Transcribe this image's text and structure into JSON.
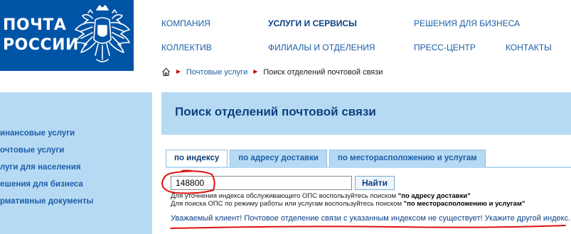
{
  "logo": {
    "line1": "ПОЧТА",
    "line2": "РОССИИ",
    "emblem": "double-headed-eagle-emblem"
  },
  "nav": {
    "company": "КОМПАНИЯ",
    "services": "УСЛУГИ И СЕРВИСЫ",
    "business": "РЕШЕНИЯ ДЛЯ БИЗНЕСА",
    "team": "КОЛЛЕКТИВ",
    "branches": "ФИЛИАЛЫ И ОТДЕЛЕНИЯ",
    "press": "ПРЕСС-ЦЕНТР",
    "contacts": "КОНТАКТЫ"
  },
  "breadcrumb": {
    "home_icon": "home-icon",
    "separator": "►",
    "postal_services": "Почтовые услуги",
    "current": "Поиск отделений почтовой связи"
  },
  "sidebar": {
    "items": [
      {
        "label": "инансовые услуги"
      },
      {
        "label": "очтовые услуги"
      },
      {
        "label": "луги для населения"
      },
      {
        "label": "ешения для бизнеса"
      },
      {
        "label": "рмативные документы"
      }
    ]
  },
  "main": {
    "title": "Поиск отделений почтовой связи",
    "tabs": [
      {
        "label": "по индексу",
        "active": true
      },
      {
        "label": "по адресу доставки",
        "active": false
      },
      {
        "label": "по месторасположению и услугам",
        "active": false
      }
    ],
    "index_value": "148800",
    "find_label": "Найти",
    "hint1_prefix": "Для уточнения индекса обслуживающего ОПС воспользуйтесь поиском ",
    "hint1_bold": "\"по адресу доставки\"",
    "hint2_prefix": "Для поиска ОПС по режиму работы или услугам воспользуйтесь поиском ",
    "hint2_bold": "\"по месторасположению и услугам\"",
    "error": "Уважаемый клиент! Почтовое отделение связи с указанным индексом не существует! Укажите другой индекс."
  },
  "colors": {
    "brand_blue": "#0054a6",
    "light_blue": "#b7daf4",
    "link_blue": "#1b5ea8",
    "annotation_red": "#e01010"
  }
}
